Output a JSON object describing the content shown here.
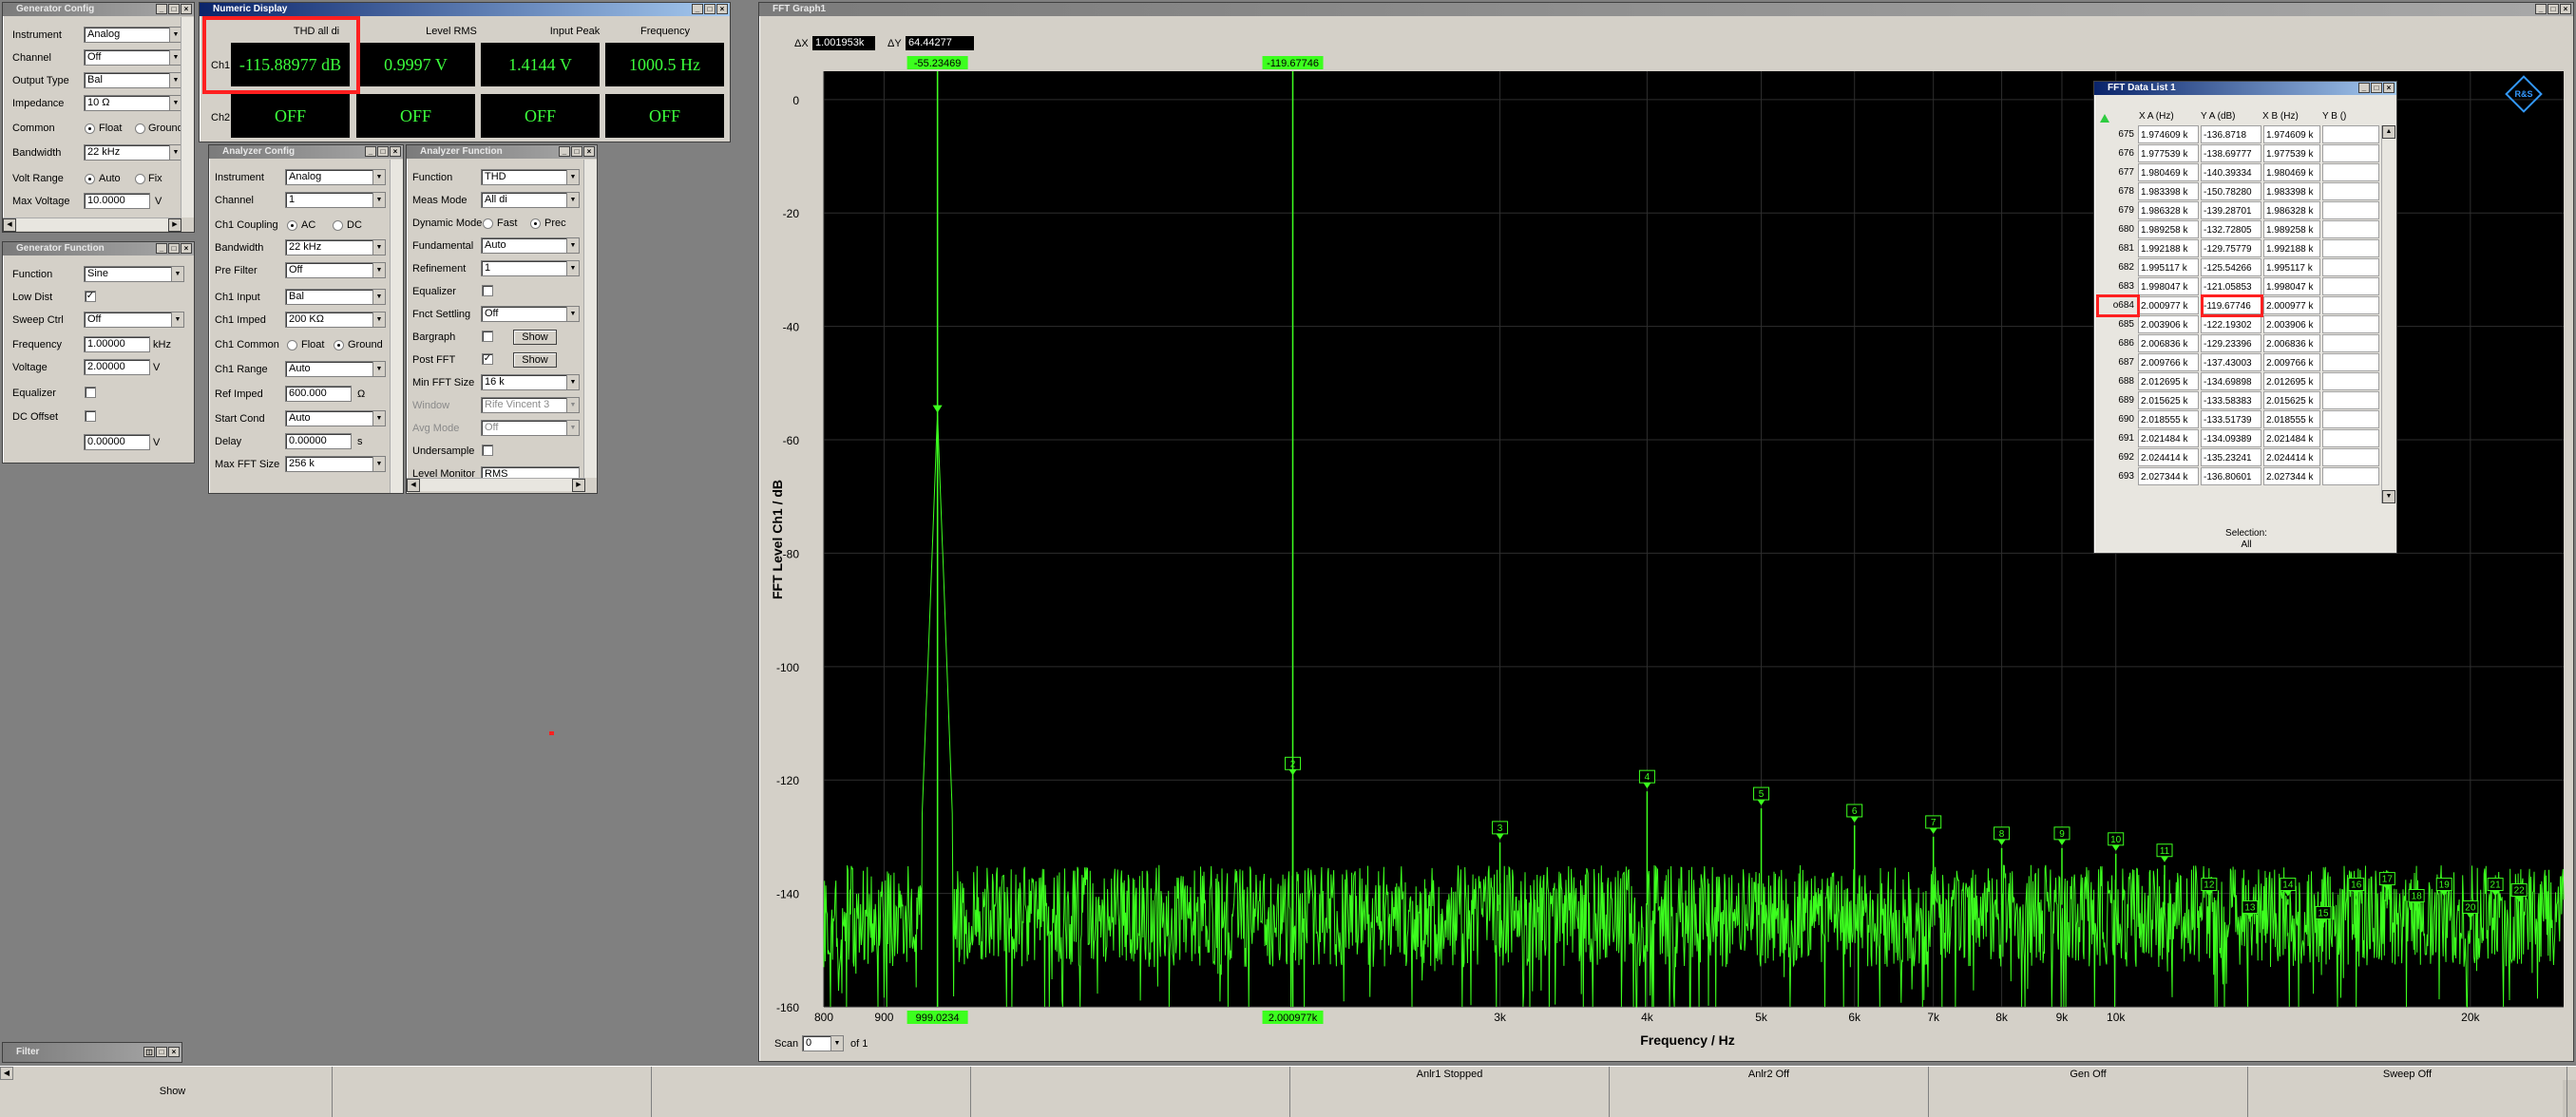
{
  "generator_config": {
    "title": "Generator Config",
    "rows": [
      {
        "label": "Instrument",
        "value": "Analog"
      },
      {
        "label": "Channel",
        "value": "Off"
      },
      {
        "label": "Output Type",
        "value": "Bal"
      },
      {
        "label": "Impedance",
        "value": "10 Ω"
      }
    ],
    "common_label": "Common",
    "common_opt1": "Float",
    "common_opt2": "Ground",
    "bandwidth_label": "Bandwidth",
    "bandwidth_value": "22 kHz",
    "volt_range_label": "Volt Range",
    "volt_range_opt1": "Auto",
    "volt_range_opt2": "Fix",
    "max_voltage_label": "Max Voltage",
    "max_voltage_value": "10.0000",
    "max_voltage_unit": "V"
  },
  "generator_function": {
    "title": "Generator Function",
    "function_label": "Function",
    "function_value": "Sine",
    "low_dist_label": "Low Dist",
    "sweep_ctrl_label": "Sweep Ctrl",
    "sweep_ctrl_value": "Off",
    "frequency_label": "Frequency",
    "frequency_value": "1.00000",
    "frequency_unit": "kHz",
    "voltage_label": "Voltage",
    "voltage_value": "2.00000",
    "voltage_unit": "V",
    "equalizer_label": "Equalizer",
    "dc_offset_label": "DC Offset",
    "dc_offset_value": "0.00000",
    "dc_offset_unit": "V"
  },
  "numeric_display": {
    "title": "Numeric Display",
    "headers": [
      "THD all di",
      "Level RMS",
      "Input Peak",
      "Frequency"
    ],
    "ch1_label": "Ch1",
    "ch2_label": "Ch2",
    "ch1_values": [
      "-115.88977 dB",
      "0.9997 V",
      "1.4144 V",
      "1000.5 Hz"
    ],
    "ch2_values": [
      "OFF",
      "OFF",
      "OFF",
      "OFF"
    ]
  },
  "analyzer_config": {
    "title": "Analyzer Config",
    "instrument_label": "Instrument",
    "instrument_value": "Analog",
    "channel_label": "Channel",
    "channel_value": "1",
    "coupling_label": "Ch1 Coupling",
    "coupling_opt1": "AC",
    "coupling_opt2": "DC",
    "bandwidth_label": "Bandwidth",
    "bandwidth_value": "22 kHz",
    "prefilter_label": "Pre Filter",
    "prefilter_value": "Off",
    "input_label": "Ch1 Input",
    "input_value": "Bal",
    "imped_label": "Ch1 Imped",
    "imped_value": "200 KΩ",
    "common_label": "Ch1 Common",
    "common_opt1": "Float",
    "common_opt2": "Ground",
    "range_label": "Ch1 Range",
    "range_value": "Auto",
    "refimped_label": "Ref Imped",
    "refimped_value": "600.000",
    "refimped_unit": "Ω",
    "startcond_label": "Start Cond",
    "startcond_value": "Auto",
    "delay_label": "Delay",
    "delay_value": "0.00000",
    "delay_unit": "s",
    "maxfft_label": "Max FFT Size",
    "maxfft_value": "256 k"
  },
  "analyzer_function": {
    "title": "Analyzer Function",
    "function_label": "Function",
    "function_value": "THD",
    "measmode_label": "Meas Mode",
    "measmode_value": "All di",
    "dynmode_label": "Dynamic Mode",
    "dynmode_opt1": "Fast",
    "dynmode_opt2": "Prec",
    "fundamental_label": "Fundamental",
    "fundamental_value": "Auto",
    "refinement_label": "Refinement",
    "refinement_value": "1",
    "equalizer_label": "Equalizer",
    "fnctsettling_label": "Fnct Settling",
    "fnctsettling_value": "Off",
    "bargraph_label": "Bargraph",
    "bargraph_btn": "Show",
    "postfft_label": "Post FFT",
    "postfft_btn": "Show",
    "minfft_label": "Min FFT Size",
    "minfft_value": "16 k",
    "window_label": "Window",
    "window_value": "Rife Vincent 3",
    "avgmode_label": "Avg Mode",
    "avgmode_value": "Off",
    "undersample_label": "Undersample",
    "level_monitor_partial": "Level Monitor",
    "level_monitor_value": "RMS"
  },
  "filter_window": {
    "title": "Filter"
  },
  "fft_graph": {
    "title": "FFT Graph1",
    "dx_label": "ΔX",
    "dx_value": "1.001953k",
    "dy_label": "ΔY",
    "dy_value": "64.44277",
    "cursor_a_label": "-55.23469",
    "cursor_b_label": "-119.67746",
    "cursor_a_x": "999.0234",
    "cursor_b_x": "2.000977k",
    "scan_label": "Scan",
    "scan_value": "0",
    "scan_of": "of 1",
    "logo": "R&S"
  },
  "chart_data": {
    "type": "line",
    "xscale": "log",
    "xlabel": "Frequency / Hz",
    "ylabel": "FFT Level Ch1 / dB",
    "xlim": [
      800,
      24000
    ],
    "ylim": [
      -160,
      5
    ],
    "x_ticks": [
      800,
      900,
      3000,
      4000,
      5000,
      6000,
      7000,
      8000,
      9000,
      10000,
      20000
    ],
    "x_tick_labels": [
      "800",
      "900",
      "3k",
      "4k",
      "5k",
      "6k",
      "7k",
      "8k",
      "9k",
      "10k",
      "20k"
    ],
    "y_ticks": [
      0,
      -20,
      -40,
      -60,
      -80,
      -100,
      -120,
      -140,
      -160
    ],
    "grid": true,
    "fundamental": {
      "x": 999.0234,
      "y": -55.23469
    },
    "harmonic_markers": [
      {
        "n": "2",
        "x": 2000.977,
        "y": -119.67746
      },
      {
        "n": "3",
        "x": 3000,
        "y": -131
      },
      {
        "n": "4",
        "x": 4000,
        "y": -122
      },
      {
        "n": "5",
        "x": 5000,
        "y": -125
      },
      {
        "n": "6",
        "x": 6000,
        "y": -128
      },
      {
        "n": "7",
        "x": 7000,
        "y": -130
      },
      {
        "n": "8",
        "x": 8000,
        "y": -132
      },
      {
        "n": "9",
        "x": 9000,
        "y": -132
      },
      {
        "n": "10",
        "x": 10000,
        "y": -133
      },
      {
        "n": "11",
        "x": 11000,
        "y": -135
      },
      {
        "n": "12",
        "x": 12000,
        "y": -141
      },
      {
        "n": "13",
        "x": 13000,
        "y": -145
      },
      {
        "n": "14",
        "x": 14000,
        "y": -141
      },
      {
        "n": "15",
        "x": 15000,
        "y": -146
      },
      {
        "n": "16",
        "x": 16000,
        "y": -141
      },
      {
        "n": "17",
        "x": 17000,
        "y": -140
      },
      {
        "n": "18",
        "x": 18000,
        "y": -143
      },
      {
        "n": "19",
        "x": 19000,
        "y": -141
      },
      {
        "n": "20",
        "x": 20000,
        "y": -145
      },
      {
        "n": "21",
        "x": 21000,
        "y": -141
      },
      {
        "n": "22",
        "x": 22000,
        "y": -142
      }
    ],
    "noise_floor_db": -140,
    "series_color": "#3cff1e"
  },
  "fft_data_list": {
    "title": "FFT Data List 1",
    "headers": [
      "X A (Hz)",
      "Y A (dB)",
      "X B (Hz)",
      "Y B ()"
    ],
    "rows": [
      {
        "idx": "675",
        "xa": "1.974609 k",
        "ya": "-136.8718",
        "xb": "1.974609 k"
      },
      {
        "idx": "676",
        "xa": "1.977539 k",
        "ya": "-138.69777",
        "xb": "1.977539 k"
      },
      {
        "idx": "677",
        "xa": "1.980469 k",
        "ya": "-140.39334",
        "xb": "1.980469 k"
      },
      {
        "idx": "678",
        "xa": "1.983398 k",
        "ya": "-150.78280",
        "xb": "1.983398 k"
      },
      {
        "idx": "679",
        "xa": "1.986328 k",
        "ya": "-139.28701",
        "xb": "1.986328 k"
      },
      {
        "idx": "680",
        "xa": "1.989258 k",
        "ya": "-132.72805",
        "xb": "1.989258 k"
      },
      {
        "idx": "681",
        "xa": "1.992188 k",
        "ya": "-129.75779",
        "xb": "1.992188 k"
      },
      {
        "idx": "682",
        "xa": "1.995117 k",
        "ya": "-125.54266",
        "xb": "1.995117 k"
      },
      {
        "idx": "683",
        "xa": "1.998047 k",
        "ya": "-121.05853",
        "xb": "1.998047 k"
      },
      {
        "idx": "o684",
        "xa": "2.000977 k",
        "ya": "-119.67746",
        "xb": "2.000977 k"
      },
      {
        "idx": "685",
        "xa": "2.003906 k",
        "ya": "-122.19302",
        "xb": "2.003906 k"
      },
      {
        "idx": "686",
        "xa": "2.006836 k",
        "ya": "-129.23396",
        "xb": "2.006836 k"
      },
      {
        "idx": "687",
        "xa": "2.009766 k",
        "ya": "-137.43003",
        "xb": "2.009766 k"
      },
      {
        "idx": "688",
        "xa": "2.012695 k",
        "ya": "-134.69898",
        "xb": "2.012695 k"
      },
      {
        "idx": "689",
        "xa": "2.015625 k",
        "ya": "-133.58383",
        "xb": "2.015625 k"
      },
      {
        "idx": "690",
        "xa": "2.018555 k",
        "ya": "-133.51739",
        "xb": "2.018555 k"
      },
      {
        "idx": "691",
        "xa": "2.021484 k",
        "ya": "-134.09389",
        "xb": "2.021484 k"
      },
      {
        "idx": "692",
        "xa": "2.024414 k",
        "ya": "-135.23241",
        "xb": "2.024414 k"
      },
      {
        "idx": "693",
        "xa": "2.027344 k",
        "ya": "-136.80601",
        "xb": "2.027344 k"
      }
    ],
    "selection_label": "Selection:",
    "selection_value": "All"
  },
  "status_bar": {
    "cells": [
      {
        "top": "",
        "bottom": "Show"
      },
      {
        "top": "",
        "bottom": ""
      },
      {
        "top": "",
        "bottom": ""
      },
      {
        "top": "",
        "bottom": ""
      },
      {
        "top": "Anlr1 Stopped",
        "bottom": ""
      },
      {
        "top": "Anlr2 Off",
        "bottom": ""
      },
      {
        "top": "Gen Off",
        "bottom": ""
      },
      {
        "top": "Sweep Off",
        "bottom": ""
      }
    ]
  }
}
